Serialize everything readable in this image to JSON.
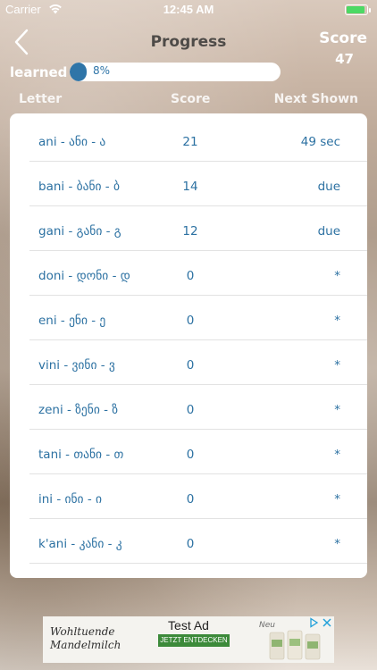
{
  "status_bar": {
    "carrier": "Carrier",
    "time": "12:45 AM"
  },
  "nav": {
    "title": "Progress",
    "score_label": "Score",
    "score_value": "47"
  },
  "progress": {
    "label": "learned",
    "percent": 8,
    "text": "8%"
  },
  "table": {
    "headers": {
      "letter": "Letter",
      "score": "Score",
      "next": "Next Shown"
    },
    "rows": [
      {
        "letter": "ani - ანი - ა",
        "score": "21",
        "next": "49 sec"
      },
      {
        "letter": "bani - ბანი - ბ",
        "score": "14",
        "next": "due"
      },
      {
        "letter": "gani - განი - გ",
        "score": "12",
        "next": "due"
      },
      {
        "letter": "doni - დონი - დ",
        "score": "0",
        "next": "*"
      },
      {
        "letter": "eni - ენი - ე",
        "score": "0",
        "next": "*"
      },
      {
        "letter": "vini - ვინი - ვ",
        "score": "0",
        "next": "*"
      },
      {
        "letter": "zeni - ზენი - ზ",
        "score": "0",
        "next": "*"
      },
      {
        "letter": "tani - თანი - თ",
        "score": "0",
        "next": "*"
      },
      {
        "letter": "ini - ინი - ი",
        "score": "0",
        "next": "*"
      },
      {
        "letter": "k'ani - კანი - კ",
        "score": "0",
        "next": "*"
      }
    ]
  },
  "ad": {
    "brand": [
      "Wohltuende",
      "Mandelmilch"
    ],
    "title": "Test Ad",
    "cta": "JETZT ENTDECKEN",
    "badge": "Neu"
  },
  "colors": {
    "accent": "#2f75a8",
    "battery": "#4cd964",
    "title": "#4e4b48"
  },
  "icons": [
    "back-chevron-icon",
    "wifi-icon",
    "battery-icon",
    "ad-play-icon",
    "ad-close-icon"
  ]
}
